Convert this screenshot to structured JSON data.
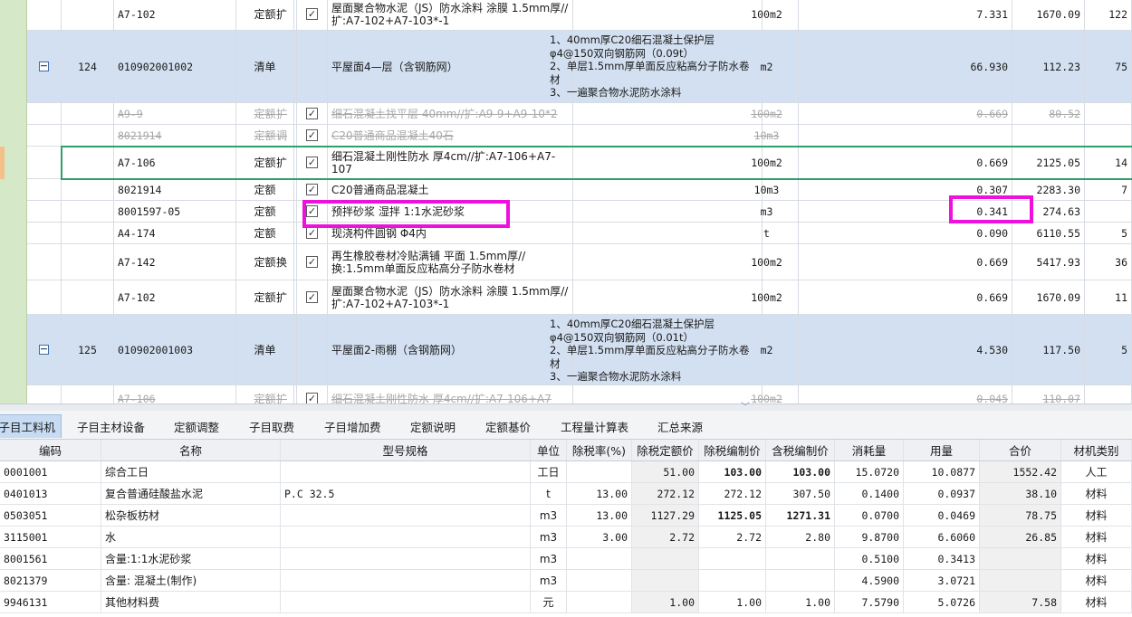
{
  "upper_rows": [
    {
      "type": "ding",
      "code": "A7-102",
      "kind": "定额",
      "mod": "扩",
      "checked": true,
      "name": "屋面聚合物水泥（JS）防水涂料 涂膜 1.5mm厚//扩:A7-102+A7-103*-1",
      "desc": "",
      "unit": "100m2",
      "qty": "7.331",
      "price": "1670.09",
      "total": "122"
    },
    {
      "type": "qd",
      "seq": "124",
      "code": "010902001002",
      "kind": "清单",
      "mod": "",
      "name": "平屋面4—层（含钢筋网）",
      "desc": "1、40mm厚C20细石混凝土保护层φ4@150双向钢筋网（0.09t）\n2、单层1.5mm厚单面反应粘高分子防水卷材\n3、一遍聚合物水泥防水涂料",
      "unit": "m2",
      "qty": "66.930",
      "price": "112.23",
      "total": "75"
    },
    {
      "type": "struck",
      "code": "A9-9",
      "kind": "定额",
      "mod": "扩",
      "checked": true,
      "name": "细石混凝土找平层 40mm//扩:A9-9+A9-10*2",
      "desc": "",
      "unit": "100m2",
      "qty": "0.669",
      "price": "80.52",
      "total": ""
    },
    {
      "type": "struck",
      "code": "8021914",
      "kind": "定额",
      "mod": "调",
      "checked": true,
      "name": "C20普通商品混凝土40石",
      "desc": "",
      "unit": "10m3",
      "qty": "",
      "price": "",
      "total": ""
    },
    {
      "type": "sel",
      "code": "A7-106",
      "kind": "定额",
      "mod": "扩",
      "checked": true,
      "name": "细石混凝土刚性防水 厚4cm//扩:A7-106+A7-107",
      "desc": "",
      "unit": "100m2",
      "qty": "0.669",
      "price": "2125.05",
      "total": "14"
    },
    {
      "type": "ding",
      "code": "8021914",
      "kind": "定额",
      "mod": "",
      "checked": true,
      "name": "C20普通商品混凝土",
      "desc": "",
      "unit": "10m3",
      "qty": "0.307",
      "price": "2283.30",
      "total": "7"
    },
    {
      "type": "ding",
      "code": "8001597-05",
      "kind": "定额",
      "mod": "",
      "checked": true,
      "name": "预拌砂浆 湿拌 1:1水泥砂浆",
      "desc": "",
      "unit": "m3",
      "qty": "0.341",
      "price": "274.63",
      "total": ""
    },
    {
      "type": "ding",
      "code": "A4-174",
      "kind": "定额",
      "mod": "",
      "checked": true,
      "name": "现浇构件圆钢 Φ4内",
      "desc": "",
      "unit": "t",
      "qty": "0.090",
      "price": "6110.55",
      "total": "5"
    },
    {
      "type": "ding",
      "code": "A7-142",
      "kind": "定额",
      "mod": "换",
      "checked": true,
      "name": "再生橡胶卷材冷贴满铺 平面 1.5mm厚//换:1.5mm单面反应粘高分子防水卷材",
      "desc": "",
      "unit": "100m2",
      "qty": "0.669",
      "price": "5417.93",
      "total": "36"
    },
    {
      "type": "ding",
      "code": "A7-102",
      "kind": "定额",
      "mod": "扩",
      "checked": true,
      "name": "屋面聚合物水泥（JS）防水涂料 涂膜 1.5mm厚//扩:A7-102+A7-103*-1",
      "desc": "",
      "unit": "100m2",
      "qty": "0.669",
      "price": "1670.09",
      "total": "11"
    },
    {
      "type": "qd",
      "seq": "125",
      "code": "010902001003",
      "kind": "清单",
      "mod": "",
      "name": "平屋面2-雨棚（含钢筋网）",
      "desc": "1、40mm厚C20细石混凝土保护层φ4@150双向钢筋网（0.01t）\n2、单层1.5mm厚单面反应粘高分子防水卷材\n3、一遍聚合物水泥防水涂料",
      "unit": "m2",
      "qty": "4.530",
      "price": "117.50",
      "total": "5"
    },
    {
      "type": "struck",
      "code": "A7-106",
      "kind": "定额",
      "mod": "扩",
      "checked": true,
      "name": "细石混凝土刚性防水 厚4cm//扩:A7-106+A7",
      "desc": "",
      "unit": "100m2",
      "qty": "0.045",
      "price": "110.07",
      "total": ""
    }
  ],
  "tabs": [
    "子目工料机",
    "子目主材设备",
    "定额调整",
    "子目取费",
    "子目增加费",
    "定额说明",
    "定额基价",
    "工程量计算表",
    "汇总来源"
  ],
  "lower_headers": [
    "编码",
    "名称",
    "型号规格",
    "单位",
    "除税率(%)",
    "除税定额价",
    "除税编制价",
    "含税编制价",
    "消耗量",
    "用量",
    "合价",
    "材机类别"
  ],
  "lower_rows": [
    [
      "0001001",
      "综合工日",
      "",
      "工日",
      "",
      "51.00",
      "103.00",
      "103.00",
      "15.0720",
      "10.0877",
      "1552.42",
      "人工"
    ],
    [
      "0401013",
      "复合普通硅酸盐水泥",
      "P.C 32.5",
      "t",
      "13.00",
      "272.12",
      "272.12",
      "307.50",
      "0.1400",
      "0.0937",
      "38.10",
      "材料"
    ],
    [
      "0503051",
      "松杂板枋材",
      "",
      "m3",
      "13.00",
      "1127.29",
      "1125.05",
      "1271.31",
      "0.0700",
      "0.0469",
      "78.75",
      "材料"
    ],
    [
      "3115001",
      "水",
      "",
      "m3",
      "3.00",
      "2.72",
      "2.72",
      "2.80",
      "9.8700",
      "6.6060",
      "26.85",
      "材料"
    ],
    [
      "8001561",
      "含量:1:1水泥砂浆",
      "",
      "m3",
      "",
      "",
      "",
      "",
      "0.5100",
      "0.3413",
      "",
      "材料"
    ],
    [
      "8021379",
      "含量: 混凝土(制作)",
      "",
      "m3",
      "",
      "",
      "",
      "",
      "4.5900",
      "3.0721",
      "",
      "材料"
    ],
    [
      "9946131",
      "其他材料费",
      "",
      "元",
      "",
      "1.00",
      "1.00",
      "1.00",
      "7.5790",
      "5.0726",
      "7.58",
      "材料"
    ]
  ],
  "colors": {
    "qd_row": "#d3e0f1",
    "highlight": "#ee11dd",
    "selection": "#2e9f6a",
    "gutter": "#d5e8c7",
    "active_tab": "#c7dcf3"
  }
}
